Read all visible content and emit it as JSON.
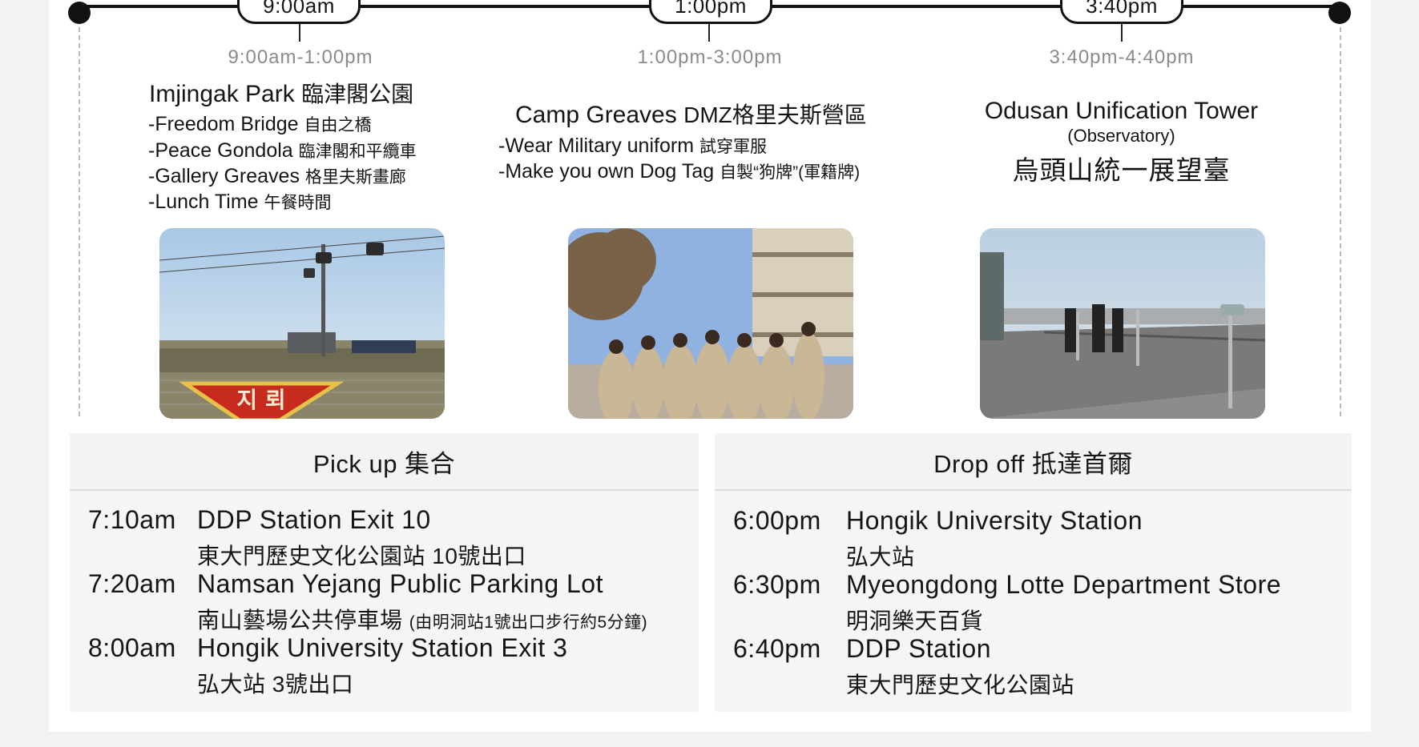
{
  "timeline": {
    "markers": [
      "9:00am",
      "1:00pm",
      "3:40pm"
    ]
  },
  "stops": [
    {
      "time_range": "9:00am-1:00pm",
      "title_en": "Imjingak Park",
      "title_zh": "臨津閣公園",
      "activities": [
        {
          "en": "-Freedom Bridge",
          "zh": "自由之橋"
        },
        {
          "en": "-Peace Gondola",
          "zh": "臨津閣和平纜車"
        },
        {
          "en": "-Gallery Greaves",
          "zh": "格里夫斯畫廊"
        },
        {
          "en": "-Lunch Time",
          "zh": "午餐時間"
        }
      ],
      "photo_sign": "지 뢰"
    },
    {
      "time_range": "1:00pm-3:00pm",
      "title_en": "Camp Greaves",
      "title_zh": "DMZ格里夫斯營區",
      "activities": [
        {
          "en": "-Wear Military uniform",
          "zh": "試穿軍服"
        },
        {
          "en": "-Make you own Dog Tag",
          "zh": "自製“狗牌”(軍籍牌)"
        }
      ]
    },
    {
      "time_range": "3:40pm-4:40pm",
      "title_en": "Odusan Unification Tower",
      "subtitle": "(Observatory)",
      "title_zh": "烏頭山統一展望臺"
    }
  ],
  "pickup": {
    "heading": "Pick up 集合",
    "rows": [
      {
        "time": "7:10am",
        "name": "DDP Station Exit 10",
        "zh": "東大門歷史文化公園站 10號出口",
        "note": ""
      },
      {
        "time": "7:20am",
        "name": "Namsan Yejang Public Parking Lot",
        "zh": "南山藝場公共停車場",
        "note": "(由明洞站1號出口步行約5分鐘)"
      },
      {
        "time": "8:00am",
        "name": "Hongik University Station Exit 3",
        "zh": "弘大站 3號出口",
        "note": ""
      }
    ]
  },
  "dropoff": {
    "heading": "Drop off 抵達首爾",
    "rows": [
      {
        "time": "6:00pm",
        "name": "Hongik University Station",
        "zh": "弘大站"
      },
      {
        "time": "6:30pm",
        "name": "Myeongdong Lotte Department Store",
        "zh": "明洞樂天百貨"
      },
      {
        "time": "6:40pm",
        "name": "DDP Station",
        "zh": "東大門歷史文化公園站"
      }
    ]
  }
}
